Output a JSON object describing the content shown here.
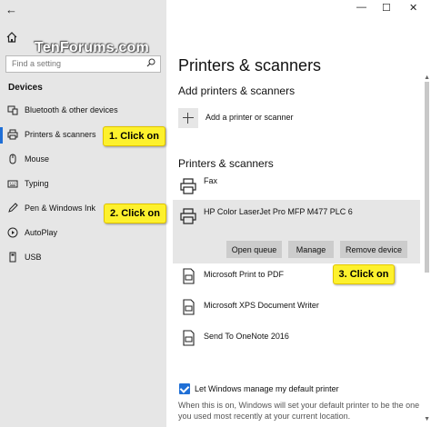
{
  "window": {
    "back": "←",
    "minimize": "—",
    "maximize": "☐",
    "close": "✕"
  },
  "watermark": "TenForums.com",
  "search": {
    "placeholder": "Find a setting"
  },
  "sidebar": {
    "section": "Devices",
    "items": [
      {
        "label": "Bluetooth & other devices",
        "icon": "bluetooth-icon"
      },
      {
        "label": "Printers & scanners",
        "icon": "printer-icon",
        "selected": true
      },
      {
        "label": "Mouse",
        "icon": "mouse-icon"
      },
      {
        "label": "Typing",
        "icon": "keyboard-icon"
      },
      {
        "label": "Pen & Windows Ink",
        "icon": "pen-icon"
      },
      {
        "label": "AutoPlay",
        "icon": "autoplay-icon"
      },
      {
        "label": "USB",
        "icon": "usb-icon"
      }
    ]
  },
  "callouts": {
    "step1": "1. Click on",
    "step2": "2. Click on",
    "step3": "3. Click on",
    "color": "#fdf12d"
  },
  "main": {
    "title": "Printers & scanners",
    "add_heading": "Add printers & scanners",
    "add_label": "Add a printer or scanner",
    "list_heading": "Printers & scanners",
    "printers": [
      {
        "name": "Fax"
      },
      {
        "name": "HP Color LaserJet Pro MFP M477 PLC 6",
        "selected": true
      },
      {
        "name": "Microsoft Print to PDF"
      },
      {
        "name": "Microsoft XPS Document Writer"
      },
      {
        "name": "Send To OneNote 2016"
      }
    ],
    "buttons": {
      "open_queue": "Open queue",
      "manage": "Manage",
      "remove": "Remove device"
    },
    "checkbox_label": "Let Windows manage my default printer",
    "checkbox_checked": true,
    "description": "When this is on, Windows will set your default printer to be the one you used most recently at your current location."
  },
  "accent": "#1f6fd6"
}
